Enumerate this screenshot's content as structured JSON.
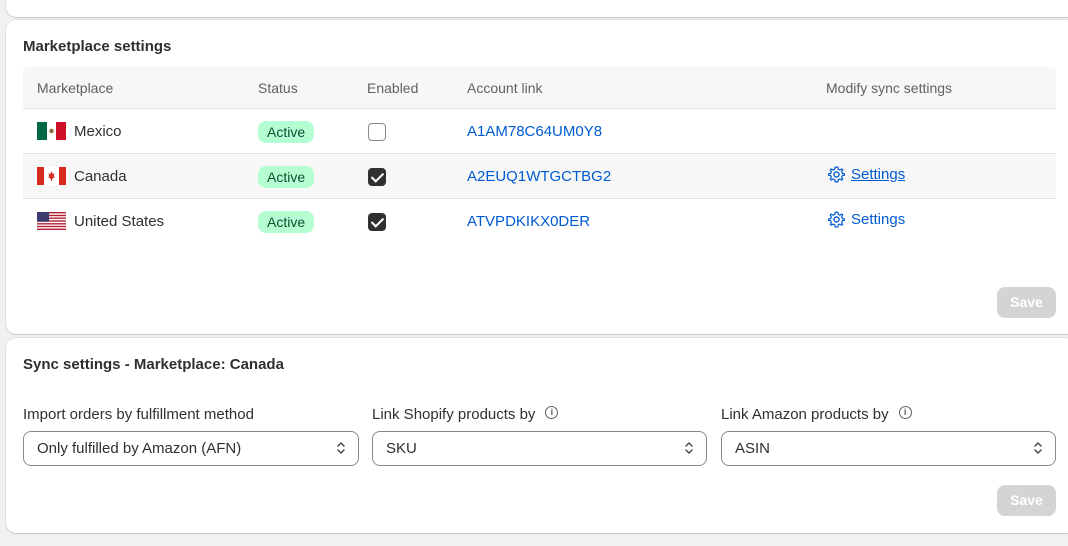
{
  "marketplace_card": {
    "title": "Marketplace settings",
    "columns": [
      "Marketplace",
      "Status",
      "Enabled",
      "Account link",
      "Modify sync settings"
    ],
    "rows": [
      {
        "marketplace": "Mexico",
        "flag": "mexico-flag",
        "status": "Active",
        "enabled": false,
        "account": "A1AM78C64UM0Y8",
        "sync_label": ""
      },
      {
        "marketplace": "Canada",
        "flag": "canada-flag",
        "status": "Active",
        "enabled": true,
        "account": "A2EUQ1WTGCTBG2",
        "sync_label": "Settings"
      },
      {
        "marketplace": "United States",
        "flag": "us-flag",
        "status": "Active",
        "enabled": true,
        "account": "ATVPDKIKX0DER",
        "sync_label": "Settings"
      }
    ],
    "save_label": "Save"
  },
  "sync_card": {
    "title": "Sync settings - Marketplace: Canada",
    "fields": [
      {
        "label": "Import orders by fulfillment method",
        "value": "Only fulfilled by Amazon (AFN)",
        "info": false
      },
      {
        "label": "Link Shopify products by",
        "value": "SKU",
        "info": true
      },
      {
        "label": "Link Amazon products by",
        "value": "ASIN",
        "info": true
      }
    ],
    "save_label": "Save"
  },
  "colors": {
    "link": "#005bd3",
    "badge_bg": "#b4fed2",
    "badge_text": "#0c5132",
    "disabled_button": "#d4d4d4"
  }
}
